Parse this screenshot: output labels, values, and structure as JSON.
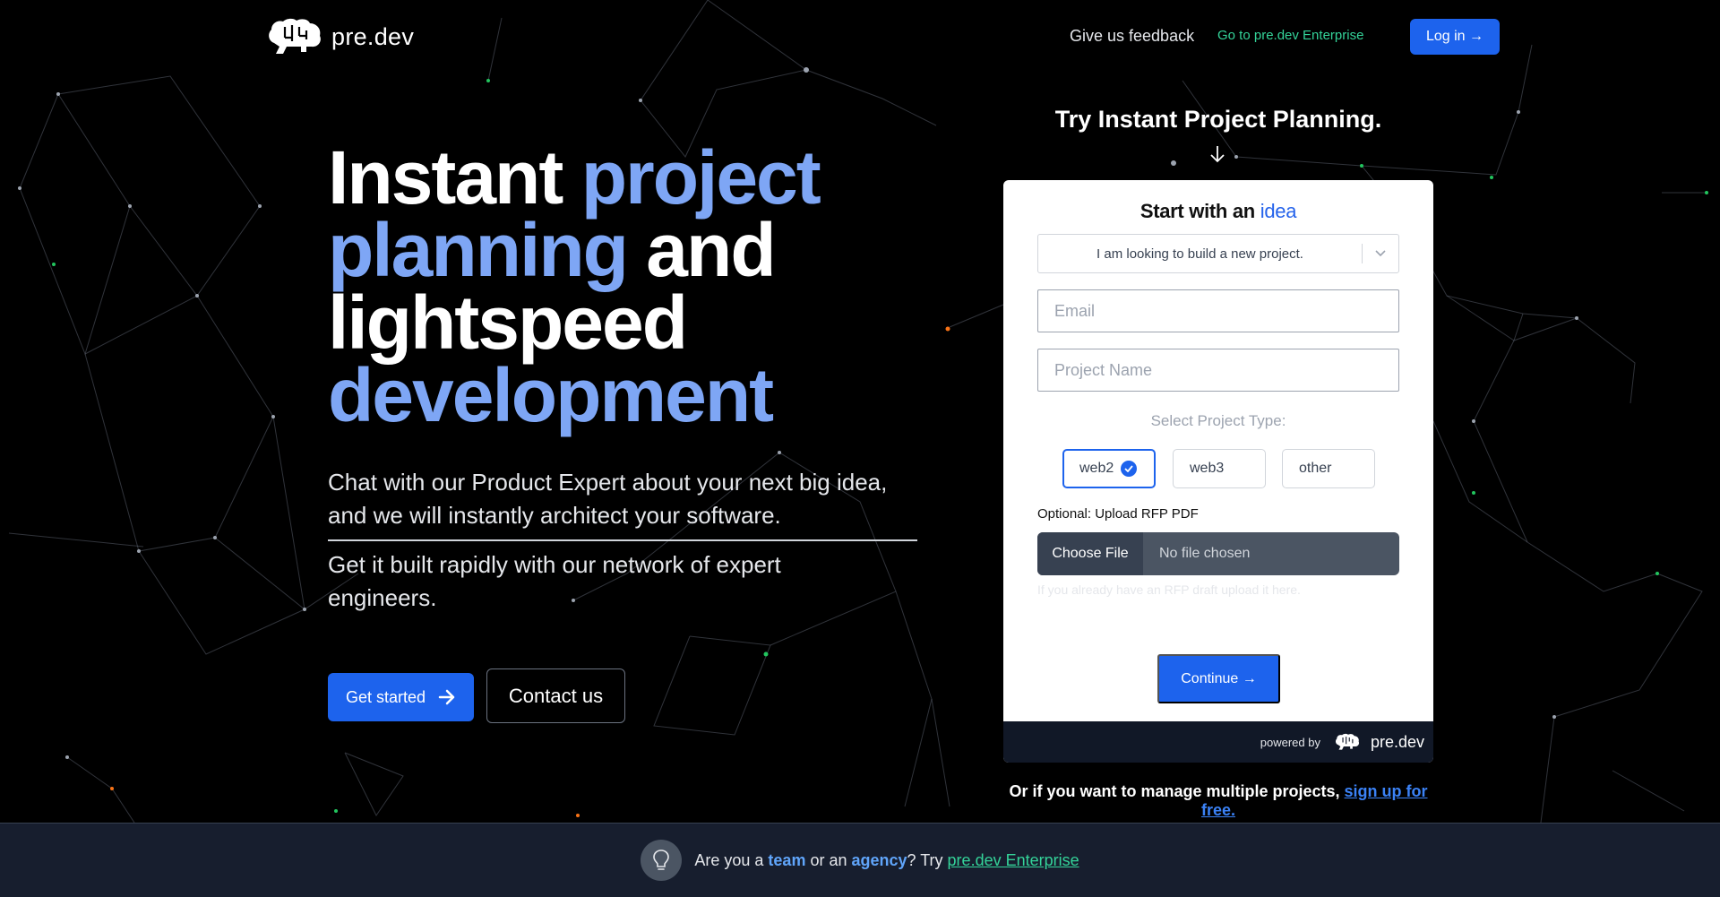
{
  "brand": {
    "name": "pre.dev"
  },
  "nav": {
    "feedback": "Give us feedback",
    "enterprise": "Go to pre.dev Enterprise",
    "login": "Log in →"
  },
  "hero": {
    "title_1": "Instant ",
    "title_2": "project planning",
    "title_3": " and lightspeed ",
    "title_4": "development",
    "description": "Chat with our Product Expert about your next big idea, and we will instantly architect your software.",
    "subtext": "Get it built rapidly with our network of expert engineers.",
    "get_started": "Get started",
    "contact": "Contact us"
  },
  "planner": {
    "heading": "Try Instant Project Planning.",
    "card_title_prefix": "Start with an ",
    "card_title_accent": "idea",
    "select_value": "I am looking to build a new project.",
    "email_placeholder": "Email",
    "project_placeholder": "Project Name",
    "type_label": "Select Project Type:",
    "types": [
      {
        "label": "web2",
        "selected": true
      },
      {
        "label": "web3",
        "selected": false
      },
      {
        "label": "other",
        "selected": false
      }
    ],
    "upload_label": "Optional: Upload RFP PDF",
    "choose_file": "Choose File",
    "file_status": "No file chosen",
    "upload_help": "If you already have an RFP draft upload it here.",
    "continue": "Continue →",
    "powered_by": "powered by",
    "footer_brand": "pre.dev",
    "manage_prefix": "Or if you want to manage multiple projects, ",
    "manage_link": "sign up for free."
  },
  "banner": {
    "t1": "Are you a ",
    "team": "team",
    "t2": " or an ",
    "agency": "agency",
    "t3": "? Try ",
    "link": "pre.dev Enterprise"
  },
  "colors": {
    "accent": "#1d63ed",
    "highlight": "#7ea6f5",
    "enterprise": "#34d399"
  }
}
